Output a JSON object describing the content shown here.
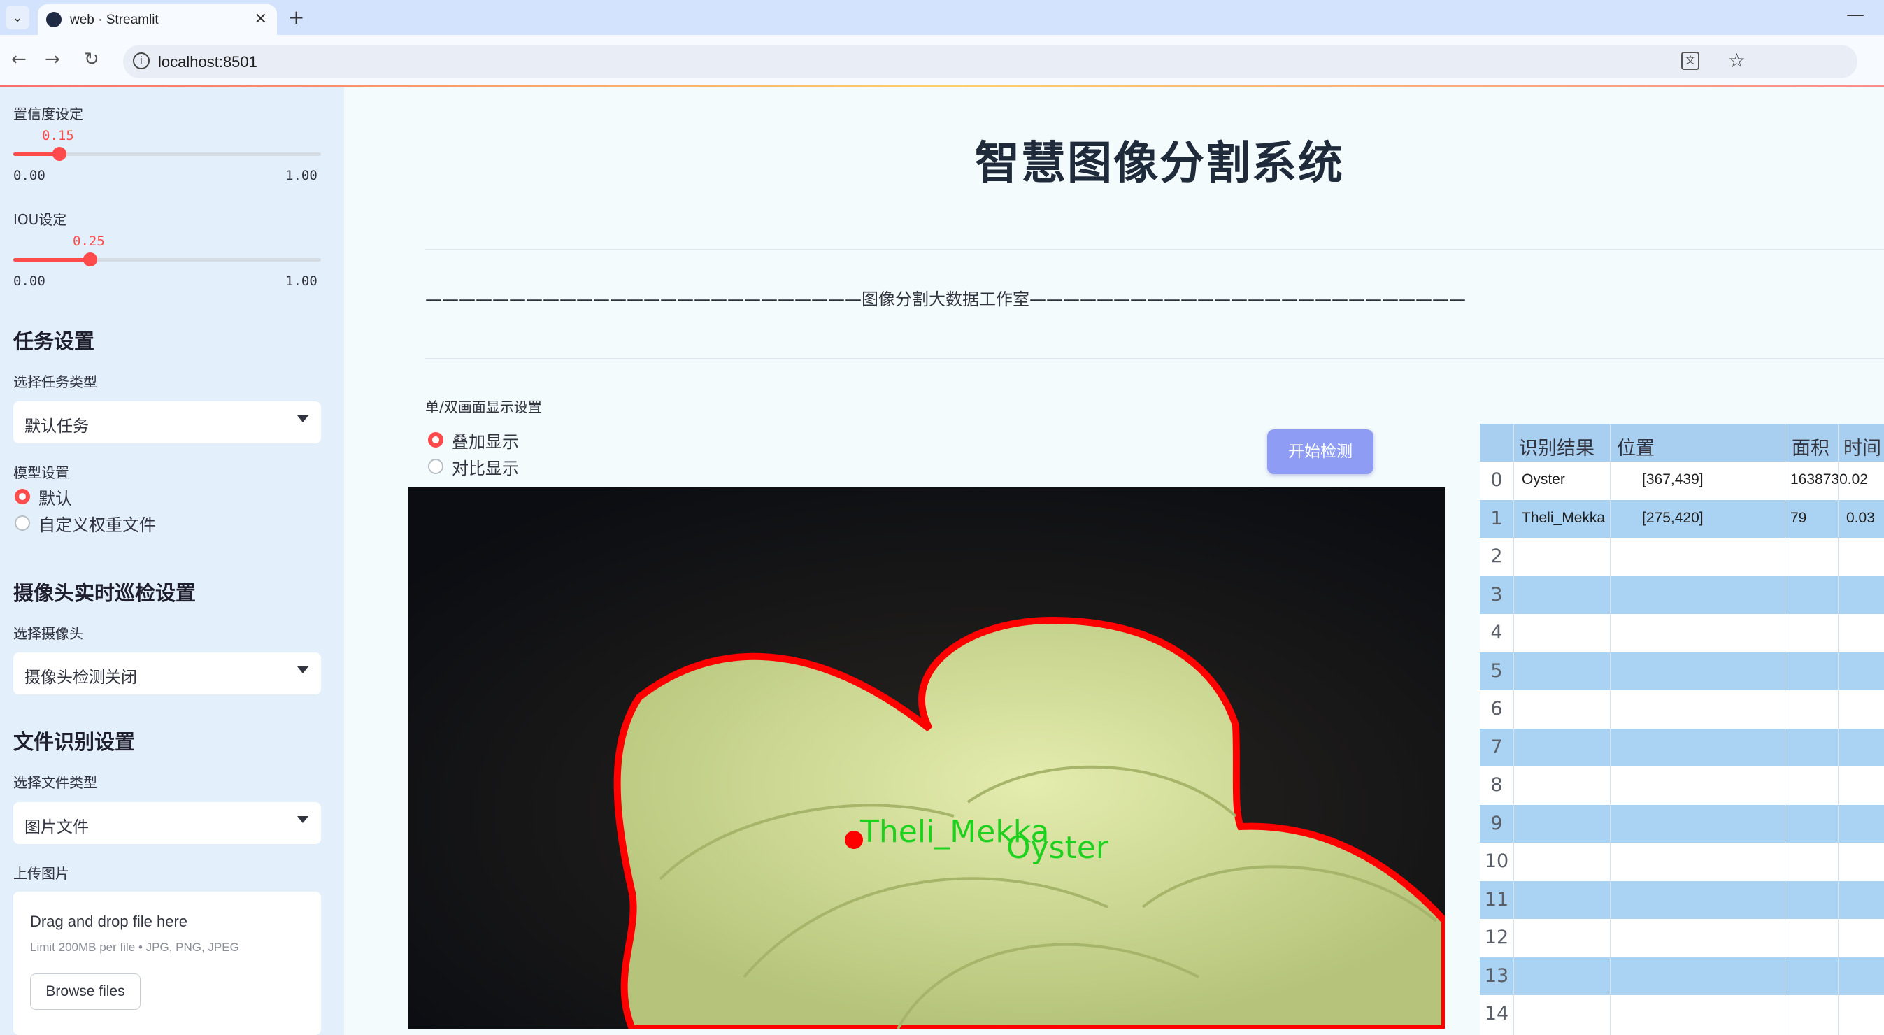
{
  "browser": {
    "tab_title": "web · Streamlit",
    "url": "localhost:8501"
  },
  "sidebar": {
    "confidence": {
      "label": "置信度设定",
      "value": "0.15",
      "min": "0.00",
      "max": "1.00",
      "fraction": 0.15
    },
    "iou": {
      "label": "IOU设定",
      "value": "0.25",
      "min": "0.00",
      "max": "1.00",
      "fraction": 0.25
    },
    "task_header": "任务设置",
    "task_type_label": "选择任务类型",
    "task_type_value": "默认任务",
    "model_label": "模型设置",
    "model_options": [
      "默认",
      "自定义权重文件"
    ],
    "camera_header": "摄像头实时巡检设置",
    "camera_label": "选择摄像头",
    "camera_value": "摄像头检测关闭",
    "file_header": "文件识别设置",
    "file_type_label": "选择文件类型",
    "file_type_value": "图片文件",
    "upload_label": "上传图片",
    "upload_title": "Drag and drop file here",
    "upload_limit": "Limit 200MB per file • JPG, PNG, JPEG",
    "browse_label": "Browse files"
  },
  "main": {
    "title": "智慧图像分割系统",
    "studio": "——————————————————————————图像分割大数据工作室——————————————————————————",
    "display_label": "单/双画面显示设置",
    "display_options": [
      "叠加显示",
      "对比显示"
    ],
    "start_button": "开始检测",
    "detections": [
      "Theli_Mekka",
      "Oyster"
    ]
  },
  "table": {
    "columns": [
      "识别结果",
      "位置",
      "面积",
      "时间"
    ],
    "rows": [
      [
        "Oyster",
        "[367,439]",
        "1638730.02",
        ""
      ],
      [
        "Theli_Mekka",
        "[275,420]",
        "79",
        "0.03"
      ]
    ],
    "indices": [
      "0",
      "1",
      "2",
      "3",
      "4",
      "5",
      "6",
      "7",
      "8",
      "9",
      "10",
      "11",
      "12",
      "13",
      "14"
    ]
  },
  "colors": {
    "accent": "#ff4b4b",
    "button": "#8e9cf4",
    "sidebar_bg": "#e3f0fb",
    "table_header": "#a9cff0",
    "mask_outline": "#ff0000",
    "label_green": "#22cc22"
  }
}
